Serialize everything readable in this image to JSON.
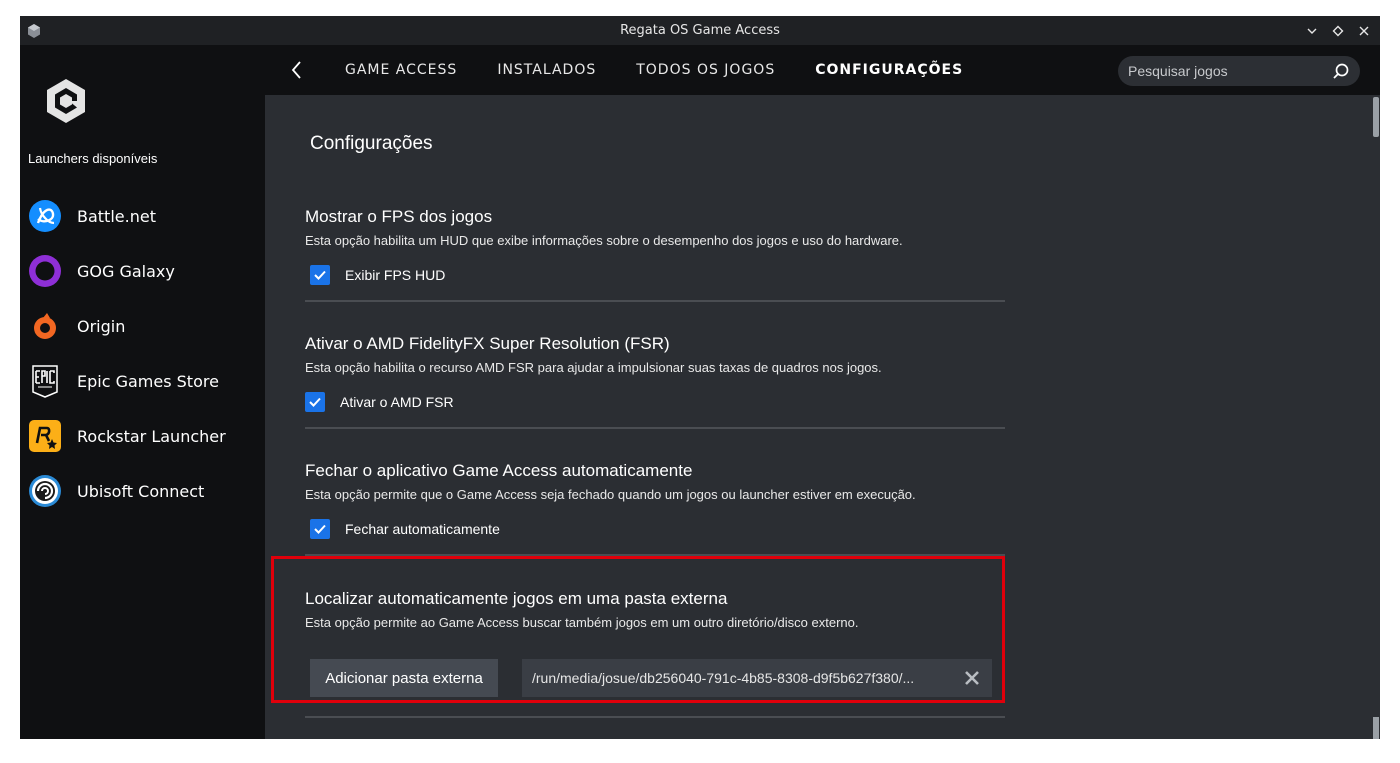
{
  "window": {
    "title": "Regata OS Game Access"
  },
  "sidebar": {
    "launchers_title": "Launchers disponíveis",
    "items": [
      {
        "label": "Battle.net",
        "icon": "battlenet-icon"
      },
      {
        "label": "GOG Galaxy",
        "icon": "gog-galaxy-icon"
      },
      {
        "label": "Origin",
        "icon": "origin-icon"
      },
      {
        "label": "Epic Games Store",
        "icon": "epic-games-icon"
      },
      {
        "label": "Rockstar Launcher",
        "icon": "rockstar-icon"
      },
      {
        "label": "Ubisoft Connect",
        "icon": "ubisoft-icon"
      }
    ]
  },
  "nav": {
    "tabs": [
      {
        "label": "GAME ACCESS",
        "active": false
      },
      {
        "label": "INSTALADOS",
        "active": false
      },
      {
        "label": "TODOS OS JOGOS",
        "active": false
      },
      {
        "label": "CONFIGURAÇÕES",
        "active": true
      }
    ],
    "search_placeholder": "Pesquisar jogos"
  },
  "page": {
    "title": "Configurações",
    "sections": [
      {
        "title": "Mostrar o FPS dos jogos",
        "description": "Esta opção habilita um HUD que exibe informações sobre o desempenho dos jogos e uso do hardware.",
        "checkbox_label": "Exibir FPS HUD",
        "checked": true
      },
      {
        "title": "Ativar o AMD FidelityFX Super Resolution (FSR)",
        "description": "Esta opção habilita o recurso AMD FSR para ajudar a impulsionar suas taxas de quadros nos jogos.",
        "checkbox_label": "Ativar o AMD FSR",
        "checked": true
      },
      {
        "title": "Fechar o aplicativo Game Access automaticamente",
        "description": "Esta opção permite que o Game Access seja fechado quando um jogos ou launcher estiver em execução.",
        "checkbox_label": "Fechar automaticamente",
        "checked": true
      },
      {
        "title": "Localizar automaticamente jogos em uma pasta externa",
        "description": "Esta opção permite ao Game Access buscar também jogos em um outro diretório/disco externo.",
        "button_label": "Adicionar pasta externa",
        "path_value": "/run/media/josue/db256040-791c-4b85-8308-d9f5b627f380/..."
      }
    ]
  },
  "colors": {
    "accent": "#1a73e8",
    "highlight": "#e0000b",
    "sidebar_bg": "#0f1012",
    "content_bg": "#2b2e33"
  }
}
